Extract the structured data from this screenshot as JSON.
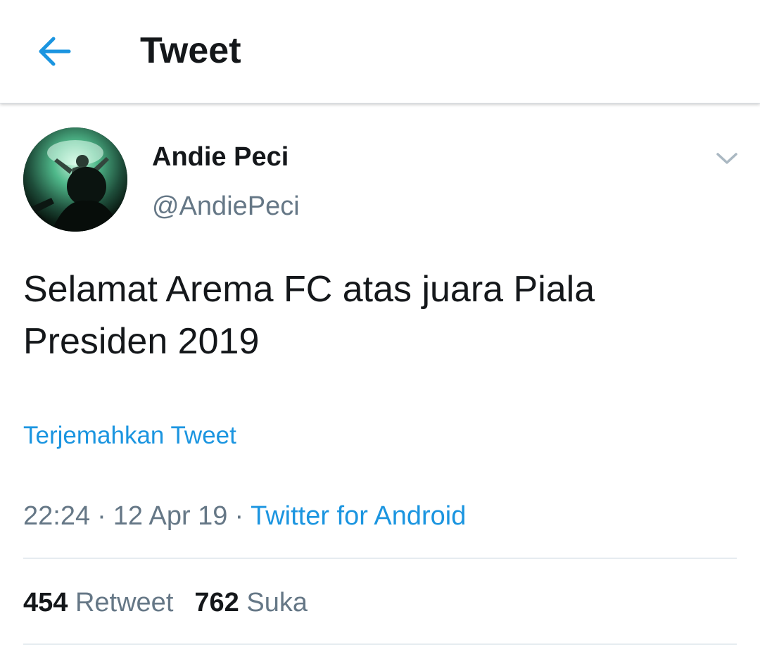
{
  "header": {
    "title": "Tweet",
    "back_icon": "arrow-left-icon"
  },
  "colors": {
    "accent": "#1b95e0",
    "text_primary": "#14171a",
    "text_secondary": "#657786",
    "divider": "#e6ecf0"
  },
  "tweet": {
    "author": {
      "display_name": "Andie Peci",
      "handle": "@AndiePeci"
    },
    "menu_icon": "chevron-down-icon",
    "text": "Selamat Arema FC atas juara Piala Presiden 2019",
    "translate_label": "Terjemahkan Tweet",
    "time": "22:24",
    "date": "12 Apr 19",
    "separator": "·",
    "source": "Twitter for Android",
    "stats": {
      "retweets_count": "454",
      "retweets_label": "Retweet",
      "likes_count": "762",
      "likes_label": "Suka"
    }
  }
}
